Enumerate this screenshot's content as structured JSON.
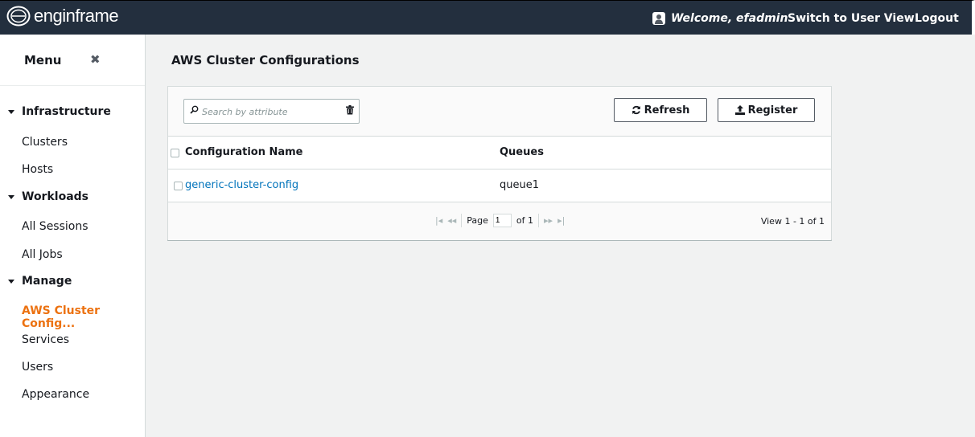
{
  "header": {
    "logo_text": "enginframe",
    "welcome": "Welcome, efadmin",
    "switch_view": "Switch to User View",
    "logout": "Logout"
  },
  "sidebar": {
    "title": "Menu",
    "close": "✖",
    "sections": [
      {
        "label": "Infrastructure",
        "items": [
          "Clusters",
          "Hosts"
        ]
      },
      {
        "label": "Workloads",
        "items": [
          "All Sessions",
          "All Jobs"
        ]
      },
      {
        "label": "Manage",
        "items": [
          "AWS Cluster Config...",
          "Services",
          "Users",
          "Appearance"
        ]
      }
    ],
    "active_item": "AWS Cluster Config..."
  },
  "main": {
    "title": "AWS Cluster Configurations",
    "search": {
      "placeholder": "Search by attribute"
    },
    "buttons": {
      "refresh": "Refresh",
      "register": "Register"
    },
    "columns": [
      "Configuration Name",
      "Queues"
    ],
    "rows": [
      {
        "name": "generic-cluster-config",
        "queues": "queue1"
      }
    ],
    "pager": {
      "page_label": "Page",
      "page": "1",
      "of": "of 1",
      "view": "View 1 - 1 of 1"
    }
  },
  "colors": {
    "header_bg": "#232f3e",
    "active": "#ec7211",
    "link": "#0073bb"
  }
}
